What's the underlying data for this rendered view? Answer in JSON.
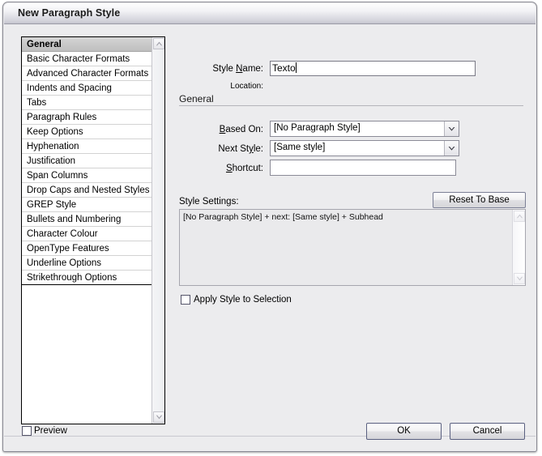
{
  "window": {
    "title": "New Paragraph Style"
  },
  "categories": [
    {
      "label": "General",
      "selected": true
    },
    {
      "label": "Basic Character Formats",
      "selected": false
    },
    {
      "label": "Advanced Character Formats",
      "selected": false
    },
    {
      "label": "Indents and Spacing",
      "selected": false
    },
    {
      "label": "Tabs",
      "selected": false
    },
    {
      "label": "Paragraph Rules",
      "selected": false
    },
    {
      "label": "Keep Options",
      "selected": false
    },
    {
      "label": "Hyphenation",
      "selected": false
    },
    {
      "label": "Justification",
      "selected": false
    },
    {
      "label": "Span Columns",
      "selected": false
    },
    {
      "label": "Drop Caps and Nested Styles",
      "selected": false
    },
    {
      "label": "GREP Style",
      "selected": false
    },
    {
      "label": "Bullets and Numbering",
      "selected": false
    },
    {
      "label": "Character Colour",
      "selected": false
    },
    {
      "label": "OpenType Features",
      "selected": false
    },
    {
      "label": "Underline Options",
      "selected": false
    },
    {
      "label": "Strikethrough Options",
      "selected": false
    }
  ],
  "form": {
    "style_name_label": "Style Name:",
    "style_name_value": "Texto",
    "location_label": "Location:",
    "location_value": "",
    "general_heading": "General",
    "based_on_label": "Based On:",
    "based_on_value": "[No Paragraph Style]",
    "next_style_label": "Next Style:",
    "next_style_value": "[Same style]",
    "shortcut_label": "Shortcut:",
    "shortcut_value": "",
    "style_settings_label": "Style Settings:",
    "style_settings_text": "[No Paragraph Style] + next: [Same style] + Subhead",
    "reset_to_base_label": "Reset To Base",
    "apply_style_label": "Apply Style to Selection"
  },
  "footer": {
    "preview_label": "Preview",
    "ok_label": "OK",
    "cancel_label": "Cancel"
  },
  "colors": {
    "dialog_background": "#ececee",
    "titlebar_top": "#fdfdfe",
    "titlebar_bottom": "#c4c4ce",
    "list_selection": "#c9c9c9",
    "button_border": "#5a6080",
    "field_border": "#8b8b97"
  }
}
